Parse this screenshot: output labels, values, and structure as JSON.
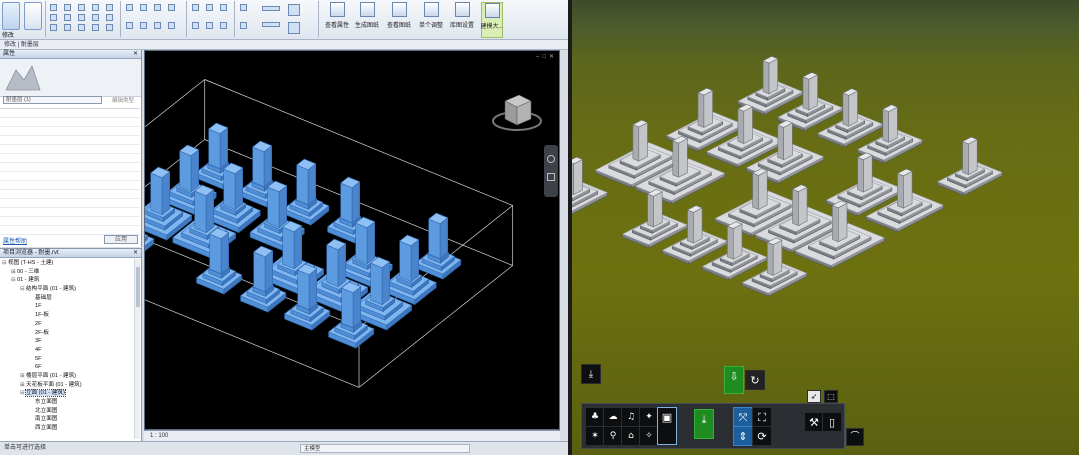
{
  "ribbon": {
    "modify_label": "修改",
    "tools": [
      {
        "label": "查看属性",
        "icon": "view-properties-icon"
      },
      {
        "label": "生成图纸",
        "icon": "generate-drawing-icon"
      },
      {
        "label": "查看图纸",
        "icon": "view-drawing-icon"
      },
      {
        "label": "单个调整",
        "icon": "single-adjust-icon"
      },
      {
        "label": "库图设置",
        "icon": "library-settings-icon"
      },
      {
        "label": "建模大...",
        "icon": "modeling-icon"
      }
    ]
  },
  "context_bar": "修改 | 耐墨层",
  "properties": {
    "title": "属性",
    "type_select": "耐墨层 (1)",
    "edit_type": "编辑类型",
    "help_link": "属性帮助",
    "apply": "应用"
  },
  "project_browser": {
    "title": "项目浏览器 - 耐墨.rvt",
    "nodes": [
      {
        "indent": 0,
        "toggle": "⊟",
        "text": "视图 (T-HS - 土建)"
      },
      {
        "indent": 1,
        "toggle": "⊞",
        "text": "00 - 三维"
      },
      {
        "indent": 1,
        "toggle": "⊟",
        "text": "01 - 建筑"
      },
      {
        "indent": 2,
        "toggle": "⊟",
        "text": "结构平面 (01 - 建筑)"
      },
      {
        "indent": 3,
        "toggle": "",
        "text": "基础层"
      },
      {
        "indent": 3,
        "toggle": "",
        "text": "1F"
      },
      {
        "indent": 3,
        "toggle": "",
        "text": "1F-板"
      },
      {
        "indent": 3,
        "toggle": "",
        "text": "2F"
      },
      {
        "indent": 3,
        "toggle": "",
        "text": "2F-板"
      },
      {
        "indent": 3,
        "toggle": "",
        "text": "3F"
      },
      {
        "indent": 3,
        "toggle": "",
        "text": "4F"
      },
      {
        "indent": 3,
        "toggle": "",
        "text": "5F"
      },
      {
        "indent": 3,
        "toggle": "",
        "text": "6F"
      },
      {
        "indent": 2,
        "toggle": "⊞",
        "text": "楼层平面 (01 - 建筑)"
      },
      {
        "indent": 2,
        "toggle": "⊞",
        "text": "天花板平面 (01 - 建筑)"
      },
      {
        "indent": 2,
        "toggle": "⊟",
        "text": "立面 (01 - 建筑)",
        "selected": true
      },
      {
        "indent": 3,
        "toggle": "",
        "text": "东立面图"
      },
      {
        "indent": 3,
        "toggle": "",
        "text": "北立面图"
      },
      {
        "indent": 3,
        "toggle": "",
        "text": "南立面图"
      },
      {
        "indent": 3,
        "toggle": "",
        "text": "西立面图"
      }
    ]
  },
  "viewport": {
    "scale": "1 : 100"
  },
  "status": {
    "left": "单击可进行选择",
    "right": "主模型"
  }
}
